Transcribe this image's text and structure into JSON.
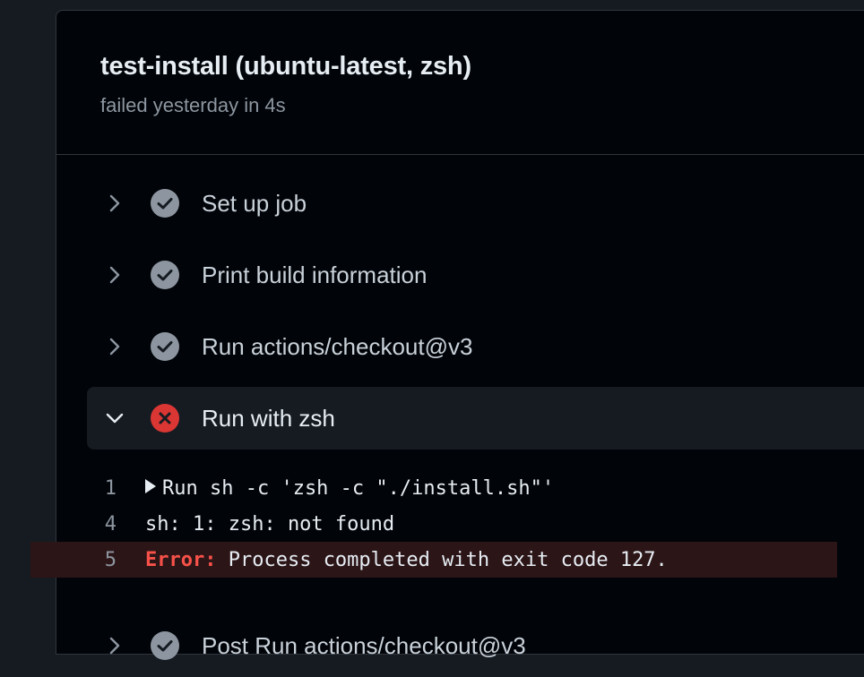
{
  "job": {
    "title": "test-install (ubuntu-latest, zsh)",
    "status": "failed yesterday in 4s"
  },
  "steps": [
    {
      "label": "Set up job",
      "state": "success",
      "expanded": false
    },
    {
      "label": "Print build information",
      "state": "success",
      "expanded": false
    },
    {
      "label": "Run actions/checkout@v3",
      "state": "success",
      "expanded": false
    },
    {
      "label": "Run with zsh",
      "state": "failure",
      "expanded": true
    },
    {
      "label": "Post Run actions/checkout@v3",
      "state": "success",
      "expanded": false
    }
  ],
  "log": [
    {
      "num": "1",
      "text": "Run sh -c 'zsh -c \"./install.sh\"'",
      "group": true
    },
    {
      "num": "4",
      "text": "sh: 1: zsh: not found"
    },
    {
      "num": "5",
      "prefix": "Error:",
      "text": " Process completed with exit code 127."
    }
  ],
  "colors": {
    "success_icon": "#8d96a0",
    "failure_icon": "#da3633",
    "error_text": "#f85149",
    "error_line_bg": "#2c1517"
  }
}
